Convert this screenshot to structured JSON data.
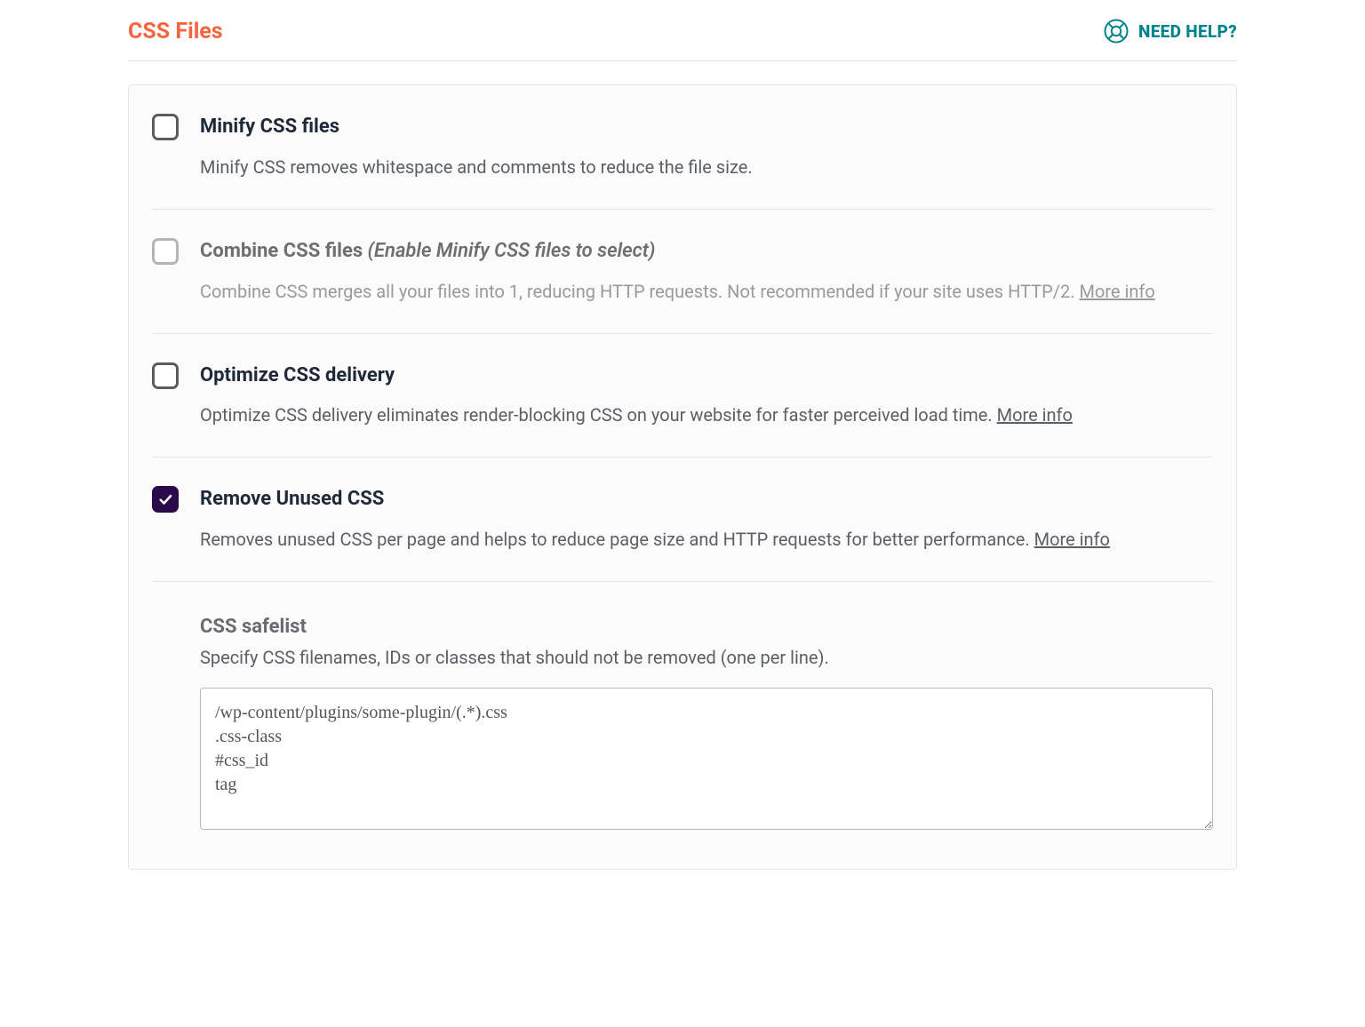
{
  "header": {
    "title": "CSS Files",
    "help_label": "NEED HELP?"
  },
  "options": {
    "minify": {
      "title": "Minify CSS files",
      "desc": "Minify CSS removes whitespace and comments to reduce the file size."
    },
    "combine": {
      "title_prefix": "Combine CSS files ",
      "title_note": "(Enable Minify CSS files to select)",
      "desc_text": "Combine CSS merges all your files into 1, reducing HTTP requests. Not recommended if your site uses HTTP/2. ",
      "more_info": "More info"
    },
    "optimize": {
      "title": "Optimize CSS delivery",
      "desc_text": "Optimize CSS delivery eliminates render-blocking CSS on your website for faster perceived load time. ",
      "more_info": "More info"
    },
    "remove_unused": {
      "title": "Remove Unused CSS",
      "desc_text": "Removes unused CSS per page and helps to reduce page size and HTTP requests for better performance. ",
      "more_info": "More info"
    }
  },
  "safelist": {
    "title": "CSS safelist",
    "desc": "Specify CSS filenames, IDs or classes that should not be removed (one per line).",
    "value": "/wp-content/plugins/some-plugin/(.*).css\n.css-class\n#css_id\ntag"
  }
}
